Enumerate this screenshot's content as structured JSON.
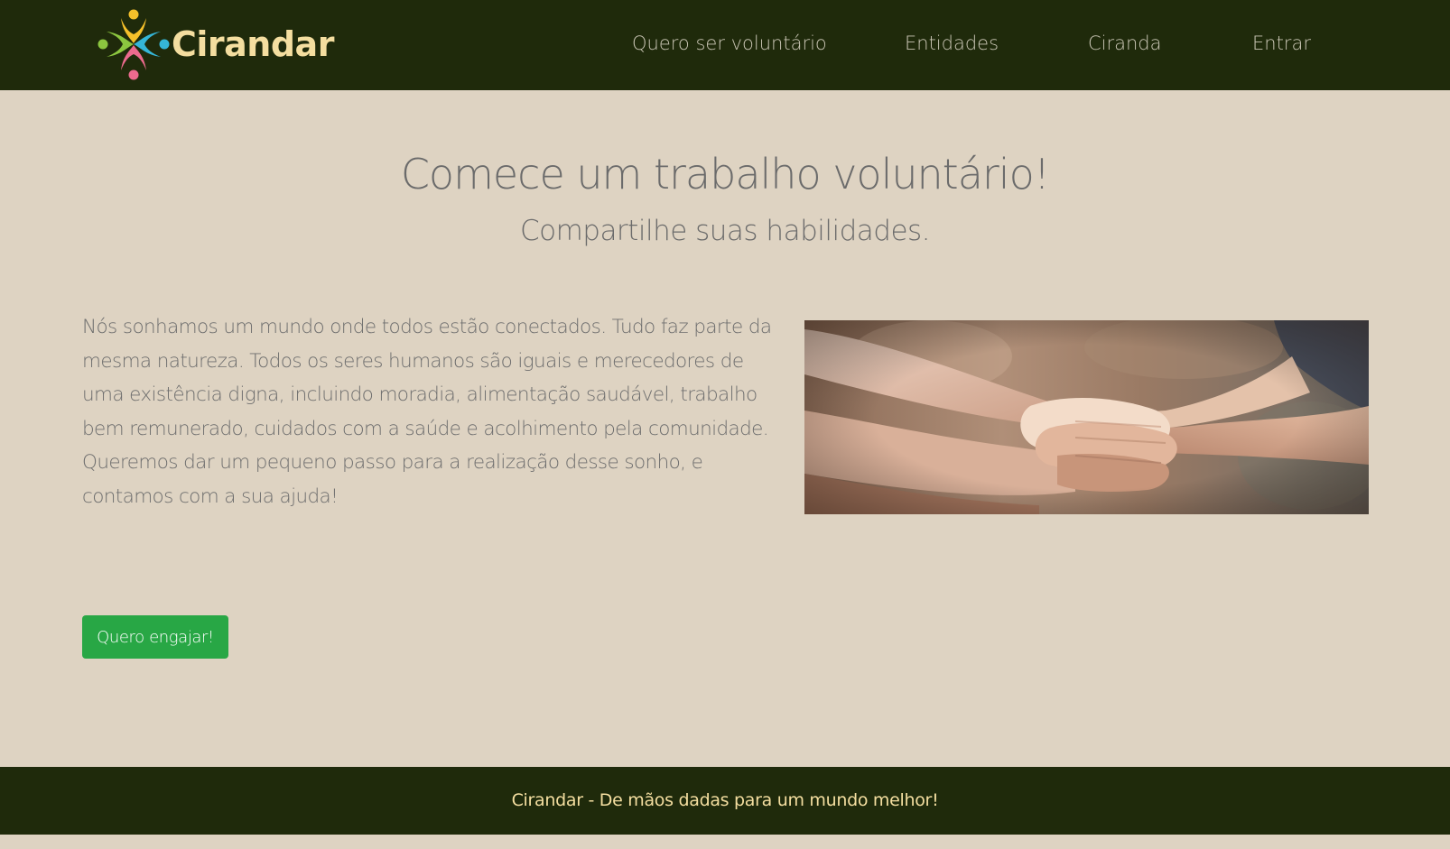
{
  "navbar": {
    "brand_name": "Cirandar",
    "links": [
      {
        "label": "Quero ser voluntário"
      },
      {
        "label": "Entidades"
      },
      {
        "label": "Ciranda"
      },
      {
        "label": "Entrar"
      }
    ]
  },
  "hero": {
    "title": "Comece um trabalho voluntário!",
    "subtitle": "Compartilhe suas habilidades."
  },
  "main": {
    "intro_text": "Nós sonhamos um mundo onde todos estão conectados. Tudo faz parte da mesma natureza. Todos os seres humanos são iguais e merecedores de uma existência digna, incluindo moradia, alimentação saudável, trabalho bem remunerado, cuidados com a saúde e acolhimento pela comunidade. Queremos dar um pequeno passo para a realização desse sonho, e contamos com a sua ajuda!",
    "cta_label": "Quero engajar!"
  },
  "footer": {
    "text": "Cirandar - De mãos dadas para um mundo melhor!"
  },
  "colors": {
    "navbar_bg": "#1f2a0b",
    "page_bg": "#ded3c2",
    "brand_text": "#f4dea0",
    "cta_bg": "#28a745",
    "logo_yellow": "#f5c02a",
    "logo_blue": "#35b6d8",
    "logo_pink": "#ec6a8e",
    "logo_green": "#8cc63f"
  }
}
